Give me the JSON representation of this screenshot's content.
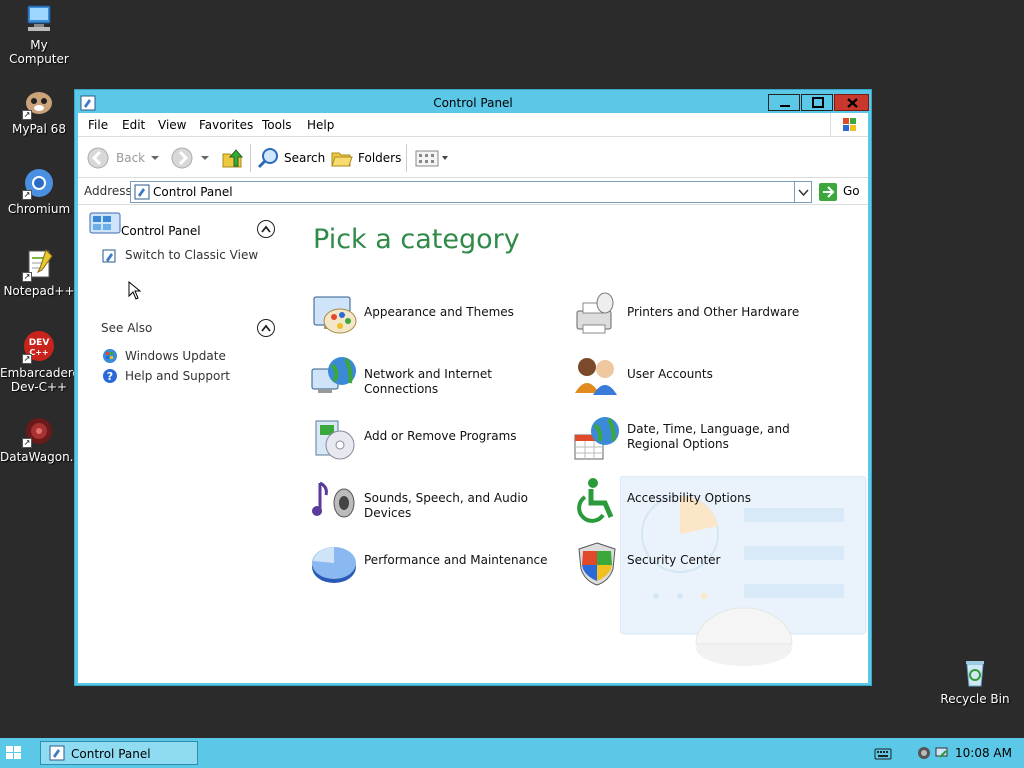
{
  "desktop": {
    "icons": [
      {
        "label": "My Computer",
        "icon": "computer-icon"
      },
      {
        "label": "MyPal 68",
        "icon": "mypal-icon"
      },
      {
        "label": "Chromium",
        "icon": "chromium-icon"
      },
      {
        "label": "Notepad++",
        "icon": "notepadpp-icon"
      },
      {
        "label": "Embarcadero Dev-C++",
        "icon": "devcpp-icon",
        "badge": "DEV C++"
      },
      {
        "label": "DataWagon...",
        "icon": "datawagon-icon"
      },
      {
        "label": "Recycle Bin",
        "icon": "recycle-bin-icon"
      }
    ]
  },
  "window": {
    "title": "Control Panel",
    "menu": [
      "File",
      "Edit",
      "View",
      "Favorites",
      "Tools",
      "Help"
    ],
    "toolbar": {
      "back": "Back",
      "search": "Search",
      "folders": "Folders"
    },
    "address": {
      "label": "Address",
      "value": "Control Panel",
      "go": "Go"
    },
    "left_pane": {
      "title": "Control Panel",
      "switch_view": "Switch to Classic View",
      "see_also": "See Also",
      "links": [
        "Windows Update",
        "Help and Support"
      ]
    },
    "main": {
      "heading": "Pick a category",
      "categories": [
        {
          "label": "Appearance and Themes",
          "icon": "appearance-themes-icon"
        },
        {
          "label": "Printers and Other Hardware",
          "icon": "printers-hardware-icon"
        },
        {
          "label": "Network and Internet Connections",
          "icon": "network-internet-icon"
        },
        {
          "label": "User Accounts",
          "icon": "user-accounts-icon"
        },
        {
          "label": "Add or Remove Programs",
          "icon": "add-remove-programs-icon"
        },
        {
          "label": "Date, Time, Language, and Regional Options",
          "icon": "date-time-regional-icon"
        },
        {
          "label": "Sounds, Speech, and Audio Devices",
          "icon": "sounds-audio-icon"
        },
        {
          "label": "Accessibility Options",
          "icon": "accessibility-icon"
        },
        {
          "label": "Performance and Maintenance",
          "icon": "performance-maintenance-icon"
        },
        {
          "label": "Security Center",
          "icon": "security-center-icon"
        }
      ]
    }
  },
  "taskbar": {
    "task_label": "Control Panel",
    "clock": "10:08 AM"
  },
  "colors": {
    "accent": "#5bc8e8",
    "heading_green": "#2f8a48",
    "close_red": "#c8382c"
  }
}
